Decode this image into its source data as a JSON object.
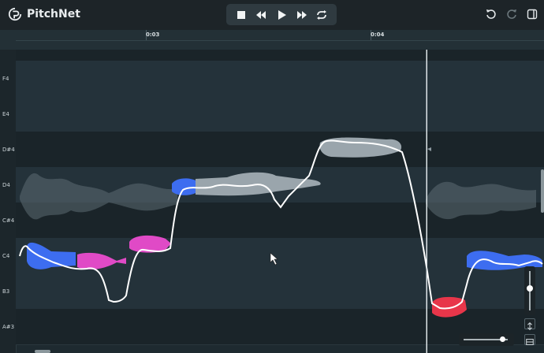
{
  "app": {
    "name": "PitchNet"
  },
  "transport": {
    "stop_icon": "stop-icon",
    "rewind_icon": "rewind-icon",
    "play_icon": "play-icon",
    "forward_icon": "fast-forward-icon",
    "loop_icon": "loop-icon"
  },
  "header_actions": {
    "undo_icon": "undo-icon",
    "redo_icon": "redo-icon",
    "panel_icon": "sidebar-toggle-icon"
  },
  "ruler": {
    "markers": [
      {
        "label": "0:03",
        "time": 3
      },
      {
        "label": "0:04",
        "time": 4
      }
    ]
  },
  "keys": [
    "F4",
    "E4",
    "D#4",
    "D4",
    "C#4",
    "C4",
    "B3",
    "A#3"
  ],
  "colors": {
    "accent_blue": "#3d6df0",
    "accent_pink": "#e04ac6",
    "accent_red": "#e8364a",
    "note_gray": "#9aa5ac",
    "pitch_line": "#ffffff"
  },
  "playhead": {
    "time": 4.25
  }
}
